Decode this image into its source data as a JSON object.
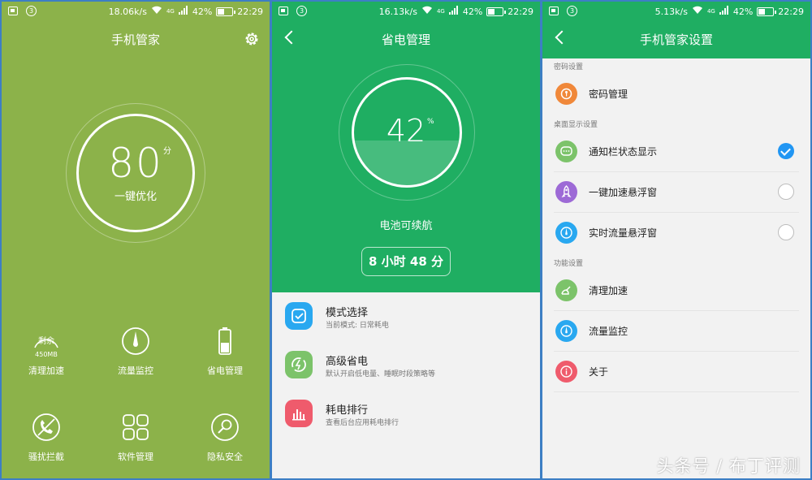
{
  "status": {
    "panel1_speed": "18.06k/s",
    "panel2_speed": "16.13k/s",
    "panel3_speed": "5.13k/s",
    "network": "4G",
    "battery": "42%",
    "time": "22:29"
  },
  "panel1": {
    "title": "手机管家",
    "score": "80",
    "score_unit": "分",
    "score_action": "一键优化",
    "tools": [
      {
        "label": "清理加速",
        "icon": "broom-icon",
        "badge_top": "剩余",
        "badge_bottom": "450MB"
      },
      {
        "label": "流量监控",
        "icon": "traffic-gauge-icon"
      },
      {
        "label": "省电管理",
        "icon": "battery-icon"
      },
      {
        "label": "骚扰拦截",
        "icon": "blocked-phone-icon"
      },
      {
        "label": "软件管理",
        "icon": "app-grid-icon"
      },
      {
        "label": "隐私安全",
        "icon": "magnifier-shield-icon"
      }
    ]
  },
  "panel2": {
    "title": "省电管理",
    "battery_percent": "42",
    "battery_unit": "%",
    "battery_level": 0.42,
    "endurance_label": "电池可续航",
    "endurance_value": "8 小时 48 分",
    "items": [
      {
        "title": "模式选择",
        "subtitle": "当前模式: 日常耗电",
        "icon": "mode-check-icon",
        "color": "#29a8f0"
      },
      {
        "title": "高级省电",
        "subtitle": "默认开启低电量、睡眠时段策略等",
        "icon": "power-save-icon",
        "color": "#7cc36a"
      },
      {
        "title": "耗电排行",
        "subtitle": "查看后台应用耗电排行",
        "icon": "bar-chart-icon",
        "color": "#ef5b6c"
      }
    ]
  },
  "panel3": {
    "title": "手机管家设置",
    "sections": {
      "password": "密码设置",
      "desktop": "桌面显示设置",
      "features": "功能设置"
    },
    "rows": {
      "password_manage": "密码管理",
      "notification_status": "通知栏状态显示",
      "speedup_float": "一键加速悬浮窗",
      "traffic_float": "实时流量悬浮窗",
      "clean_speed": "清理加速",
      "traffic_monitor": "流量监控",
      "about": "关于"
    },
    "colors": {
      "orange": "#f0883a",
      "green": "#7cc36a",
      "purple": "#9d6ad6",
      "blue": "#29a8f0",
      "red": "#ef5b6c"
    }
  },
  "watermark": "头条号 / 布丁评测",
  "colors": {
    "panel1_bg": "#8cb24a",
    "panel_green": "#1fae62",
    "check_blue": "#2196f3"
  }
}
